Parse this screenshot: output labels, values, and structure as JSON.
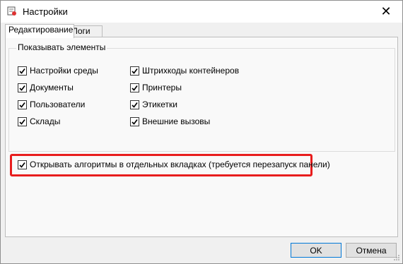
{
  "window": {
    "title": "Настройки",
    "close_label": "✕"
  },
  "tabs": [
    {
      "label": "Редактирование",
      "active": true
    },
    {
      "label": "Логи",
      "active": false
    }
  ],
  "show_elements": {
    "title": "Показывать элементы",
    "left": [
      {
        "label": "Настройки среды",
        "checked": true
      },
      {
        "label": "Документы",
        "checked": true
      },
      {
        "label": "Пользователи",
        "checked": true
      },
      {
        "label": "Склады",
        "checked": true
      }
    ],
    "right": [
      {
        "label": "Штрихкоды контейнеров",
        "checked": true
      },
      {
        "label": "Принтеры",
        "checked": true
      },
      {
        "label": "Этикетки",
        "checked": true
      },
      {
        "label": "Внешние вызовы",
        "checked": true
      }
    ]
  },
  "open_algorithms": {
    "label": "Открывать алгоритмы в отдельных вкладках (требуется перезапуск панели)",
    "checked": true
  },
  "buttons": {
    "ok": "OK",
    "cancel": "Отмена"
  },
  "colors": {
    "highlight": "#e81d1d",
    "default_button_border": "#0078d7"
  }
}
